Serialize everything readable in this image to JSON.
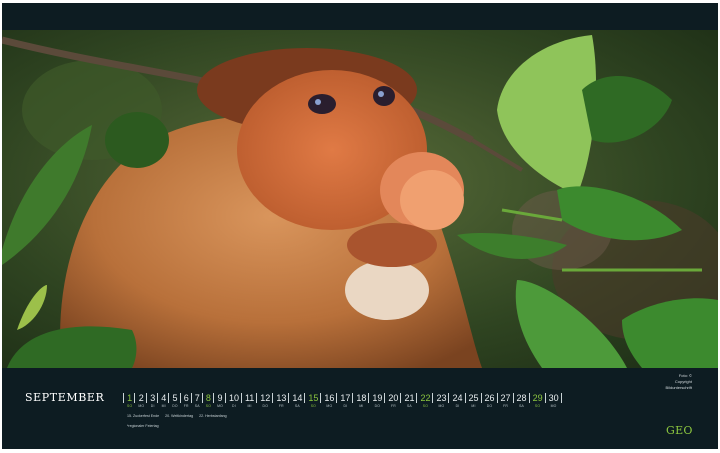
{
  "calendar": {
    "month": "SEPTEMBER",
    "days": [
      {
        "num": "1",
        "wd": "SO",
        "sunday": true
      },
      {
        "num": "2",
        "wd": "MO"
      },
      {
        "num": "3",
        "wd": "DI"
      },
      {
        "num": "4",
        "wd": "MI"
      },
      {
        "num": "5",
        "wd": "DO"
      },
      {
        "num": "6",
        "wd": "FR"
      },
      {
        "num": "7",
        "wd": "SA"
      },
      {
        "num": "8",
        "wd": "SO",
        "sunday": true
      },
      {
        "num": "9",
        "wd": "MO"
      },
      {
        "num": "10",
        "wd": "DI"
      },
      {
        "num": "11",
        "wd": "MI"
      },
      {
        "num": "12",
        "wd": "DO"
      },
      {
        "num": "13",
        "wd": "FR"
      },
      {
        "num": "14",
        "wd": "SA"
      },
      {
        "num": "15",
        "wd": "SO",
        "sunday": true
      },
      {
        "num": "16",
        "wd": "MO"
      },
      {
        "num": "17",
        "wd": "DI"
      },
      {
        "num": "18",
        "wd": "MI"
      },
      {
        "num": "19",
        "wd": "DO"
      },
      {
        "num": "20",
        "wd": "FR"
      },
      {
        "num": "21",
        "wd": "SA"
      },
      {
        "num": "22",
        "wd": "SO",
        "sunday": true
      },
      {
        "num": "23",
        "wd": "MO"
      },
      {
        "num": "24",
        "wd": "DI"
      },
      {
        "num": "25",
        "wd": "MI"
      },
      {
        "num": "26",
        "wd": "DO"
      },
      {
        "num": "27",
        "wd": "FR"
      },
      {
        "num": "28",
        "wd": "SA"
      },
      {
        "num": "29",
        "wd": "SO",
        "sunday": true
      },
      {
        "num": "30",
        "wd": "MO"
      }
    ],
    "holidays": [
      "15. Zuckerfest Ende",
      "20. Weltkindertag",
      "22. Herbstanfang"
    ],
    "note": "*regionaler Feiertag"
  },
  "credit": {
    "line1": "Foto: © Copyright",
    "line2": "Bildunterschrift"
  },
  "brand": {
    "logo": "GEO"
  },
  "colors": {
    "background": "#0d1c22",
    "accent_green": "#8cc63f",
    "text": "#e9eef0"
  }
}
